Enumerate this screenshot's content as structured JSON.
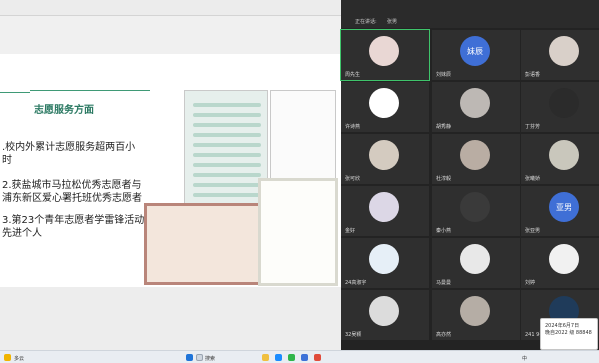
{
  "slide": {
    "title": "志愿服务方面",
    "lines": [
      ".校内外累计志愿服务超两百小",
      "时",
      "2.获盐城市马拉松优秀志愿者与",
      "浦东新区爱心署托班优秀志愿者",
      "3.第23个青年志愿者学雷锋活动",
      "先进个人"
    ]
  },
  "meeting": {
    "top_tabs": [
      "正在讲话:",
      "张男"
    ],
    "participants": [
      {
        "name": "周先生",
        "initials": "",
        "avatar_color": "#e9d7d4",
        "active": true
      },
      {
        "name": "刘妹辰",
        "initials": "妹辰",
        "avatar_color": "#3f6fd6",
        "active": false
      },
      {
        "name": "彭语香",
        "initials": "",
        "avatar_color": "#d9d0c9",
        "active": false
      },
      {
        "name": "许诗燕",
        "initials": "",
        "avatar_color": "#ffffff",
        "active": false
      },
      {
        "name": "胡秀静",
        "initials": "",
        "avatar_color": "#bdb8b4",
        "active": false
      },
      {
        "name": "丁芬芳",
        "initials": "",
        "avatar_color": "#2b2b2b",
        "active": false
      },
      {
        "name": "张可欣",
        "initials": "",
        "avatar_color": "#d4cbc0",
        "active": false
      },
      {
        "name": "杜淳毅",
        "initials": "",
        "avatar_color": "#b9ada3",
        "active": false
      },
      {
        "name": "张曦娇",
        "initials": "",
        "avatar_color": "#c9c7bc",
        "active": false
      },
      {
        "name": "金好",
        "initials": "",
        "avatar_color": "#dcd7e6",
        "active": false
      },
      {
        "name": "秦小燕",
        "initials": "",
        "avatar_color": "#3a3a3a",
        "active": false
      },
      {
        "name": "张亚男",
        "initials": "亚男",
        "avatar_color": "#3f6fd6",
        "active": false
      },
      {
        "name": "24高淑宇",
        "initials": "",
        "avatar_color": "#e6eff7",
        "active": false
      },
      {
        "name": "马曼曼",
        "initials": "",
        "avatar_color": "#e8e8e8",
        "active": false
      },
      {
        "name": "刘婷",
        "initials": "",
        "avatar_color": "#f1f1f1",
        "active": false
      },
      {
        "name": "32吴颖",
        "initials": "",
        "avatar_color": "#dcdcdc",
        "active": false
      },
      {
        "name": "高亦然",
        "initials": "",
        "avatar_color": "#b5ada5",
        "active": false
      },
      {
        "name": "241 9张丽娟",
        "initials": "",
        "avatar_color": "#1f3b5a",
        "active": false
      }
    ]
  },
  "toast": {
    "line1": "2024年6月7日",
    "line2": "晚自2022 级 88848"
  },
  "taskbar": {
    "search_label": "搜索",
    "weather": "多云",
    "lang": "中"
  }
}
